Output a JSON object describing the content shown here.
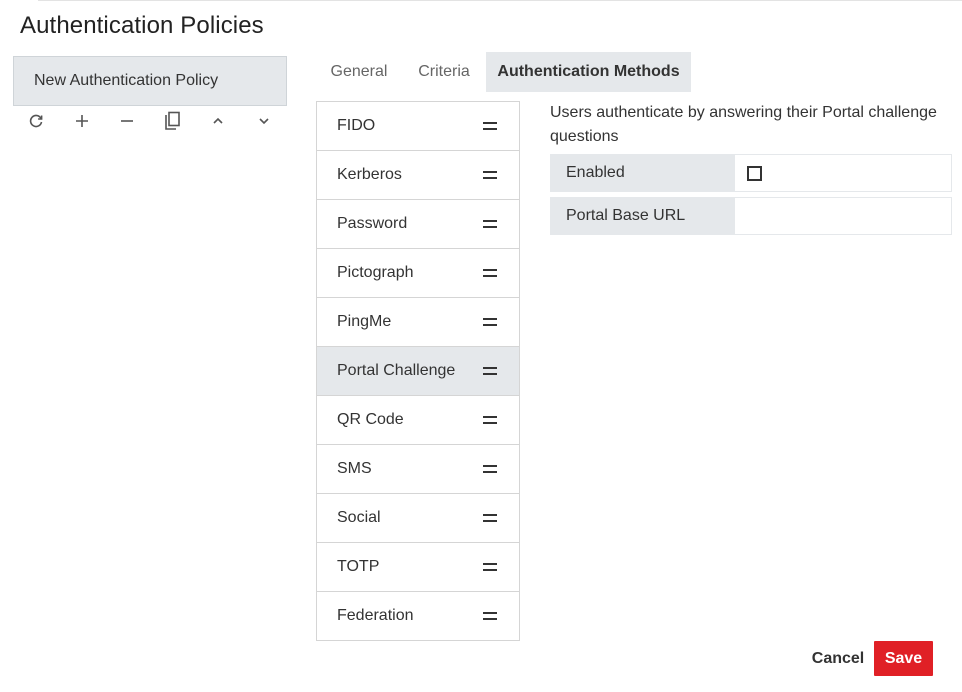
{
  "page": {
    "title": "Authentication Policies"
  },
  "policies": {
    "items": [
      {
        "label": "New Authentication Policy"
      }
    ],
    "toolbar": {
      "icons": [
        "refresh-icon",
        "add-icon",
        "remove-icon",
        "copy-icon",
        "chevron-up-icon",
        "chevron-down-icon"
      ]
    }
  },
  "tabs": [
    {
      "label": "General",
      "active": false
    },
    {
      "label": "Criteria",
      "active": false
    },
    {
      "label": "Authentication Methods",
      "active": true
    }
  ],
  "methods": {
    "selected": "Portal Challenge",
    "items": [
      {
        "label": "FIDO"
      },
      {
        "label": "Kerberos"
      },
      {
        "label": "Password"
      },
      {
        "label": "Pictograph"
      },
      {
        "label": "PingMe"
      },
      {
        "label": "Portal Challenge"
      },
      {
        "label": "QR Code"
      },
      {
        "label": "SMS"
      },
      {
        "label": "Social"
      },
      {
        "label": "TOTP"
      },
      {
        "label": "Federation"
      }
    ]
  },
  "detail": {
    "description": "Users authenticate by answering their Portal challenge questions",
    "fields": {
      "enabled": {
        "label": "Enabled",
        "checked": false
      },
      "portal_base_url": {
        "label": "Portal Base URL",
        "value": ""
      }
    }
  },
  "footer": {
    "cancel_label": "Cancel",
    "save_label": "Save"
  },
  "colors": {
    "accent": "#e02026",
    "selected_bg": "#e5e8eb",
    "border": "#d5d5d5"
  }
}
